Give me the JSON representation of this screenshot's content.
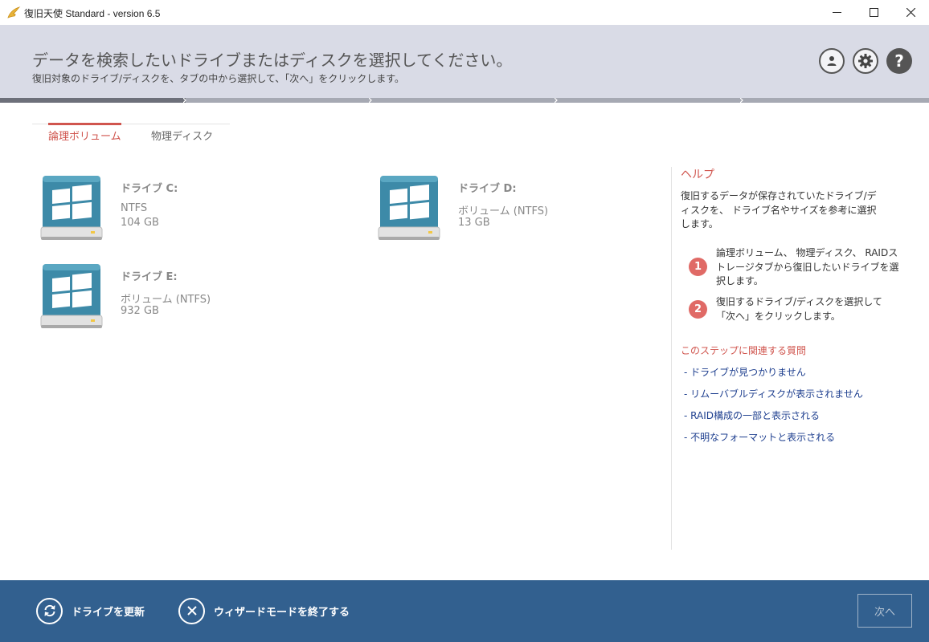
{
  "window": {
    "title": "復旧天使 Standard - version 6.5"
  },
  "header": {
    "title": "データを検索したいドライブまたはディスクを選択してください。",
    "subtitle": "復旧対象のドライブ/ディスクを、タブの中から選択して、「次へ」をクリックします。"
  },
  "progress": {
    "current_step": 1,
    "total_steps": 5
  },
  "tabs": [
    {
      "label": "論理ボリューム",
      "active": true
    },
    {
      "label": "物理ディスク",
      "active": false
    }
  ],
  "drives": [
    {
      "name": "ドライブ C:",
      "filesystem": "NTFS",
      "size": "104 GB"
    },
    {
      "name": "ドライブ D:",
      "filesystem": "ボリューム (NTFS)",
      "size": "13 GB"
    },
    {
      "name": "ドライブ E:",
      "filesystem": "ボリューム (NTFS)",
      "size": "932 GB"
    }
  ],
  "help": {
    "title": "ヘルプ",
    "description": "復旧するデータが保存されていたドライブ/ディスクを、 ドライブ名やサイズを参考に選択します。",
    "steps": [
      {
        "number": "1",
        "text": "論理ボリューム、 物理ディスク、 RAIDストレージタブから復旧したいドライブを選択します。"
      },
      {
        "number": "2",
        "text": "復旧するドライブ/ディスクを選択して「次へ」をクリックします。"
      }
    ],
    "faq_title": "このステップに関連する質問",
    "faq_links": [
      "- ドライブが見つかりません",
      "- リムーバブルディスクが表示されません",
      "- RAID構成の一部と表示される",
      "- 不明なフォーマットと表示される"
    ]
  },
  "footer": {
    "refresh_label": "ドライブを更新",
    "exit_label": "ウィザードモードを終了する",
    "next_label": "次へ"
  },
  "colors": {
    "accent": "#d0554e",
    "footer_bg": "#32608f",
    "header_bg": "#d9dbe6",
    "drive_icon": "#3d8aa8",
    "link": "#1e3f8f"
  },
  "icons": {
    "app": "angel-wing-icon",
    "account": "account-icon",
    "settings": "gear-icon",
    "help": "help-icon",
    "drive": "windows-drive-icon",
    "refresh": "refresh-icon",
    "exit": "close-icon"
  }
}
